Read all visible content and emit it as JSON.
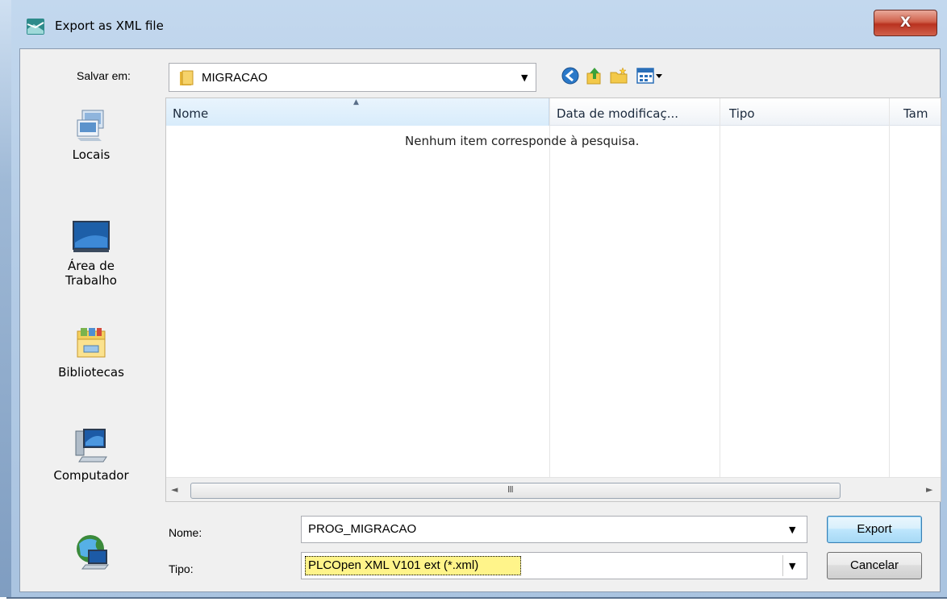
{
  "window": {
    "title": "Export as XML file",
    "close_glyph": "X",
    "accent": "#b4cce6"
  },
  "toolbar": {
    "save_in_label": "Salvar em:",
    "location": "MIGRACAO",
    "icons": [
      "back-icon",
      "up-folder-icon",
      "new-folder-icon",
      "view-menu-icon"
    ]
  },
  "places": [
    {
      "label_line1": "Locais",
      "label_line2": "",
      "icon": "recent-places-icon"
    },
    {
      "label_line1": "Área de",
      "label_line2": "Trabalho",
      "icon": "desktop-icon"
    },
    {
      "label_line1": "Bibliotecas",
      "label_line2": "",
      "icon": "libraries-icon"
    },
    {
      "label_line1": "Computador",
      "label_line2": "",
      "icon": "computer-icon"
    },
    {
      "label_line1": "",
      "label_line2": "",
      "icon": "network-icon"
    }
  ],
  "filelist": {
    "columns": [
      "Nome",
      "Data de modificaç...",
      "Tipo",
      "Tam"
    ],
    "empty_message": "Nenhum item corresponde à pesquisa.",
    "scroll_grip": "III"
  },
  "form": {
    "name_label": "Nome:",
    "name_value": "PROG_MIGRACAO",
    "type_label": "Tipo:",
    "type_value": "PLCOpen XML V101 ext (*.xml)",
    "export_label": "Export",
    "cancel_label": "Cancelar"
  }
}
